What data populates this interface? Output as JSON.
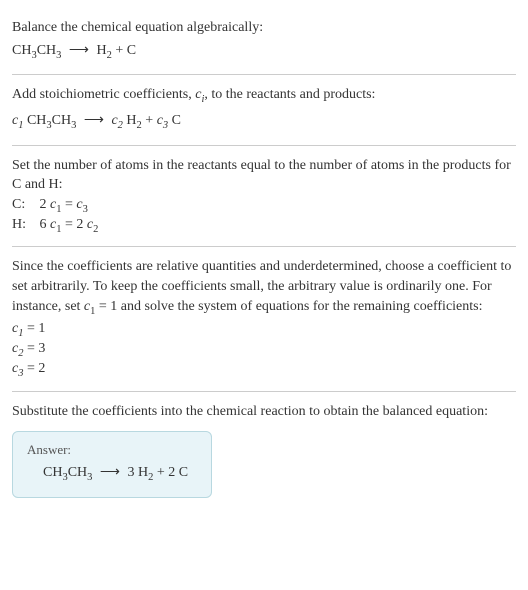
{
  "section1": {
    "title": "Balance the chemical equation algebraically:",
    "equation_lhs": "CH",
    "equation_lhs2": "CH",
    "equation_rhs1": "H",
    "equation_rhs2": "C"
  },
  "section2": {
    "title": "Add stoichiometric coefficients, ",
    "title_var": "c",
    "title_sub": "i",
    "title_end": ", to the reactants and products:",
    "c1": "c",
    "c2": "c",
    "c3": "c"
  },
  "section3": {
    "title": "Set the number of atoms in the reactants equal to the number of atoms in the products for C and H:",
    "rowC_label": "C:",
    "rowC_eq_lhs": "2 ",
    "rowC_eq_rhs": "",
    "rowH_label": "H:",
    "rowH_eq_lhs": "6 ",
    "rowH_eq_rhs": "2 "
  },
  "section4": {
    "title": "Since the coefficients are relative quantities and underdetermined, choose a coefficient to set arbitrarily. To keep the coefficients small, the arbitrary value is ordinarily one. For instance, set ",
    "title_mid": " = 1 and solve the system of equations for the remaining coefficients:",
    "c1_val": " = 1",
    "c2_val": " = 3",
    "c3_val": " = 2"
  },
  "section5": {
    "title": "Substitute the coefficients into the chemical reaction to obtain the balanced equation:",
    "answer_label": "Answer:",
    "result_lhs": "CH",
    "result_lhs2": "CH",
    "result_rhs1": "3 H",
    "result_rhs2": "2 C"
  },
  "arrow": "⟶"
}
